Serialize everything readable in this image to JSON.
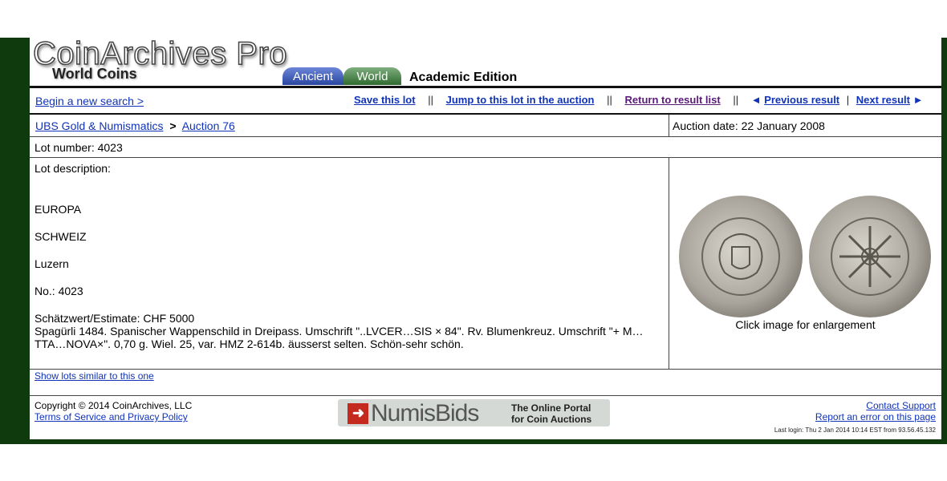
{
  "header": {
    "logo_title": "CoinArchives Pro",
    "logo_subtitle": "World Coins",
    "tabs": [
      {
        "label": "Ancient"
      },
      {
        "label": "World"
      }
    ],
    "edition": "Academic Edition"
  },
  "nav": {
    "begin_search": "Begin a new search >",
    "save_lot": "Save this lot",
    "jump_to_auction": "Jump to this lot in the auction",
    "return_to_list": "Return to result list",
    "previous_result": "Previous result",
    "next_result": "Next result",
    "sep": "||",
    "pipe": "|",
    "prev_arrow": "◄",
    "next_arrow": "►"
  },
  "lot": {
    "auction_house": "UBS Gold & Numismatics",
    "crumb_sep": ">",
    "auction_name": "Auction 76",
    "auction_date": "Auction date: 22 January 2008",
    "lot_number": "Lot number: 4023",
    "description_label": "Lot description:",
    "description_lines": [
      "EUROPA",
      "SCHWEIZ",
      "Luzern",
      "No.: 4023",
      "Schätzwert/Estimate: CHF 5000",
      "Spagürli 1484. Spanischer Wappenschild in Dreipass. Umschrift \"..LVCER…SIS × 84\". Rv. Blumenkreuz. Umschrift \"+ M…TTA…NOVA×\". 0,70 g. Wiel. 25, var. HMZ 2-614b. äusserst selten. Schön-sehr schön."
    ],
    "image_caption": "Click image for enlargement",
    "similar_lots": "Show lots similar to this one"
  },
  "footer": {
    "copyright": "Copyright © 2014  CoinArchives, LLC",
    "terms": "Terms of Service and Privacy Policy",
    "contact": "Contact Support",
    "report_error": "Report an error on this page",
    "last_login": "Last login: Thu 2 Jan 2014 10:14 EST from 93.56.45.132",
    "numisbids_word": "NumisBids",
    "numisbids_tag_1": "The Online Portal",
    "numisbids_tag_2": "for Coin Auctions"
  },
  "colors": {
    "frame": "#0e3a0e",
    "link": "#1033b8",
    "visited_link": "#5a1a7a",
    "numisbids_red": "#c52a1f"
  }
}
